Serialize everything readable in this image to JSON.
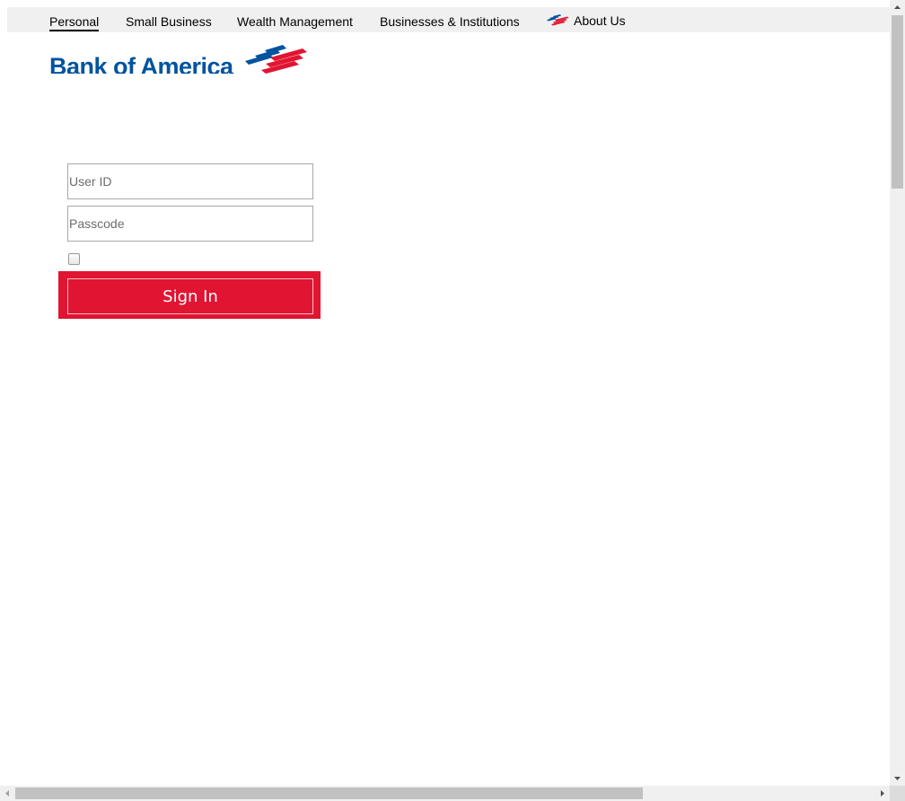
{
  "topnav": {
    "items": [
      {
        "label": "Personal",
        "active": true
      },
      {
        "label": "Small Business",
        "active": false
      },
      {
        "label": "Wealth Management",
        "active": false
      },
      {
        "label": "Businesses & Institutions",
        "active": false
      },
      {
        "label": "About Us",
        "active": false,
        "icon": "boa-flag-icon"
      }
    ]
  },
  "logo": {
    "text": "Bank of America",
    "icon": "boa-flag-icon",
    "colors": {
      "text": "#0053a0",
      "stripe_blue": "#0053a0",
      "stripe_red": "#e11432"
    }
  },
  "login": {
    "user_id_placeholder": "User ID",
    "user_id_value": "",
    "passcode_placeholder": "Passcode",
    "passcode_value": "",
    "remember_checked": false,
    "signin_label": "Sign In"
  },
  "colors": {
    "accent": "#e11432",
    "nav_bg": "#f0f0f0"
  }
}
